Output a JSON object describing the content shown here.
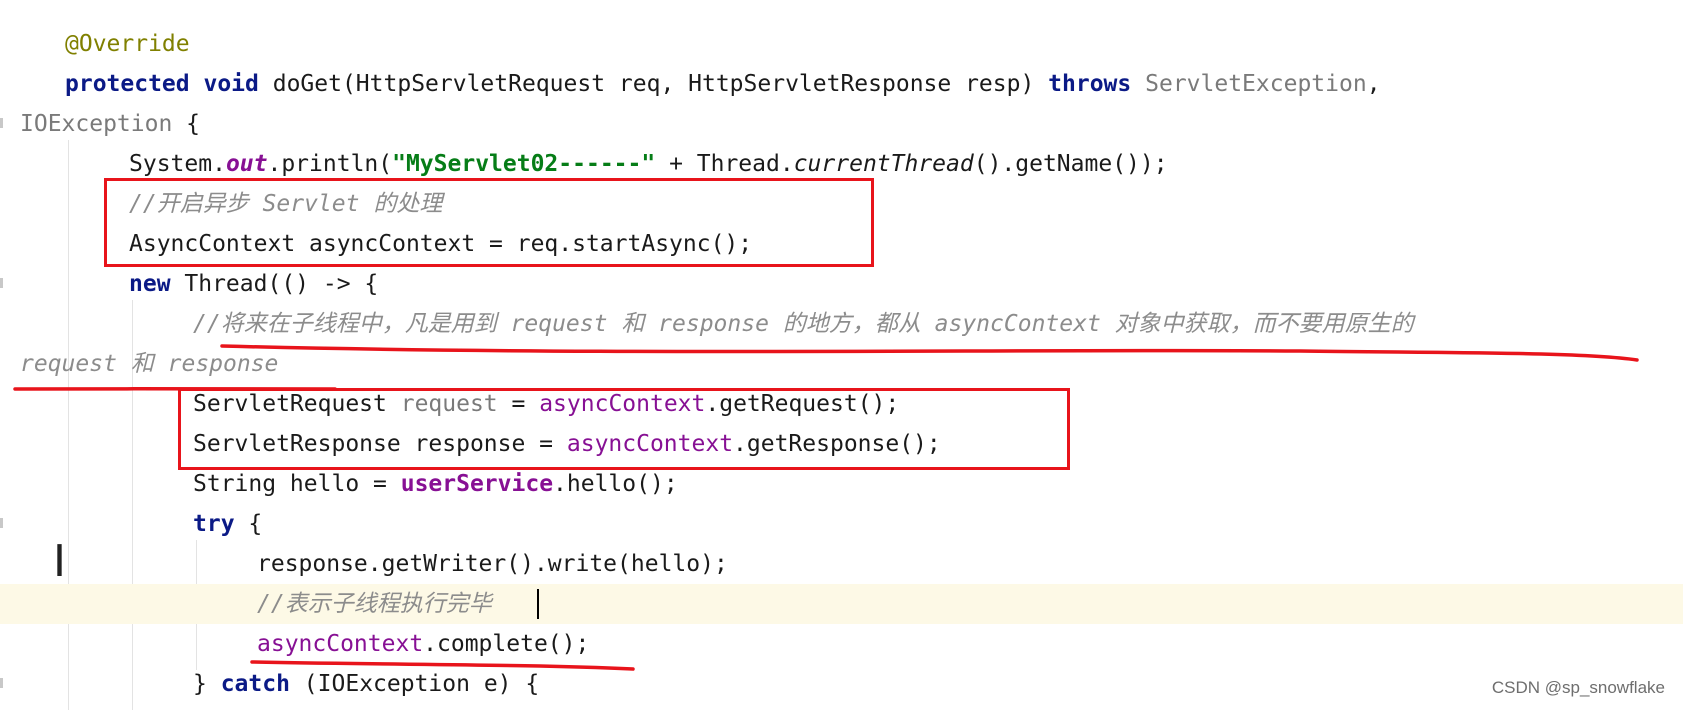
{
  "code_lines": [
    {
      "tokens": [
        {
          "t": "@Override",
          "c": "ann"
        }
      ]
    },
    {
      "tokens": [
        {
          "t": "protected",
          "c": "kw"
        },
        {
          "t": " "
        },
        {
          "t": "void",
          "c": "kw"
        },
        {
          "t": " doGet(HttpServletRequest req, HttpServletResponse resp) "
        },
        {
          "t": "throws",
          "c": "kw"
        },
        {
          "t": " "
        },
        {
          "t": "ServletException",
          "c": "gray"
        },
        {
          "t": ","
        }
      ]
    },
    {
      "tokens": [
        {
          "t": "IOException",
          "c": "gray"
        },
        {
          "t": " {"
        }
      ]
    },
    {
      "tokens": [
        {
          "t": "System."
        },
        {
          "t": "out",
          "c": "fld"
        },
        {
          "t": ".println("
        },
        {
          "t": "\"MyServlet02------\"",
          "c": "str"
        },
        {
          "t": " + Thread."
        },
        {
          "t": "currentThread",
          "c": "ital"
        },
        {
          "t": "().getName());"
        }
      ]
    },
    {
      "tokens": [
        {
          "t": "//开启异步 Servlet 的处理",
          "c": "cmt"
        }
      ]
    },
    {
      "tokens": [
        {
          "t": "AsyncContext asyncContext = req.startAsync();"
        }
      ]
    },
    {
      "tokens": [
        {
          "t": "new",
          "c": "kw"
        },
        {
          "t": " Thread(() -> {"
        }
      ]
    },
    {
      "tokens": [
        {
          "t": "//将来在子线程中，凡是用到 request 和 response 的地方，都从 asyncContext 对象中获取，而不要用原生的",
          "c": "cmt"
        }
      ]
    },
    {
      "tokens": [
        {
          "t": "request 和 response",
          "c": "cmt"
        }
      ]
    },
    {
      "tokens": [
        {
          "t": "ServletRequest "
        },
        {
          "t": "request",
          "c": "gray"
        },
        {
          "t": " = "
        },
        {
          "t": "asyncContext",
          "c": "mem"
        },
        {
          "t": ".getRequest();"
        }
      ]
    },
    {
      "tokens": [
        {
          "t": "ServletResponse response = "
        },
        {
          "t": "asyncContext",
          "c": "mem"
        },
        {
          "t": ".getResponse();"
        }
      ]
    },
    {
      "tokens": [
        {
          "t": "String hello = "
        },
        {
          "t": "userService",
          "c": "memb"
        },
        {
          "t": ".hello();"
        }
      ]
    },
    {
      "tokens": [
        {
          "t": "try",
          "c": "kw"
        },
        {
          "t": " {"
        }
      ]
    },
    {
      "tokens": [
        {
          "t": "response.getWriter().write(hello);"
        }
      ]
    },
    {
      "tokens": [
        {
          "t": "//表示子线程执行完毕",
          "c": "cmt"
        }
      ]
    },
    {
      "tokens": [
        {
          "t": "asyncContext",
          "c": "mem"
        },
        {
          "t": ".complete();"
        }
      ]
    },
    {
      "tokens": [
        {
          "t": "} "
        },
        {
          "t": "catch",
          "c": "kw"
        },
        {
          "t": " (IOException e) {"
        }
      ]
    }
  ],
  "watermark": "CSDN @sp_snowflake"
}
